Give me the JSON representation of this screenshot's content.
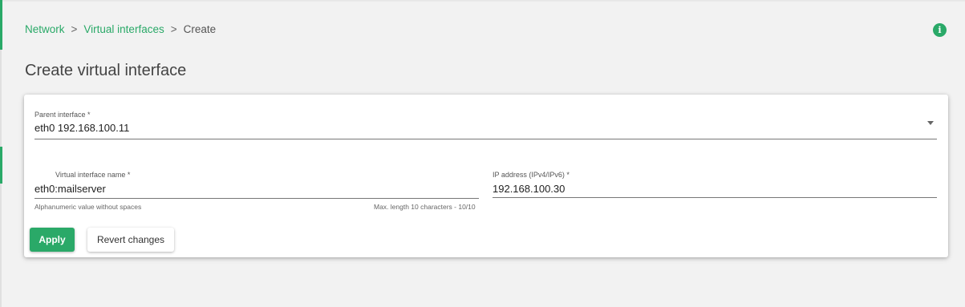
{
  "breadcrumb": {
    "items": [
      "Network",
      "Virtual interfaces"
    ],
    "separator": ">",
    "current": "Create"
  },
  "info_icon": {
    "name": "info-icon",
    "glyph": "i"
  },
  "page": {
    "title": "Create virtual interface"
  },
  "form": {
    "parent_interface": {
      "label": "Parent interface *",
      "value": "eth0 192.168.100.11"
    },
    "virtual_name": {
      "label": "Virtual interface name *",
      "value": "eth0:mailserver",
      "helper": "Alphanumeric value without spaces",
      "counter": "Max. length 10 characters - 10/10"
    },
    "ip_address": {
      "label": "IP address (IPv4/IPv6) *",
      "value": "192.168.100.30"
    }
  },
  "buttons": {
    "apply": "Apply",
    "revert": "Revert changes"
  },
  "colors": {
    "accent": "#2aa968",
    "background": "#f2f2f2",
    "card": "#ffffff"
  }
}
